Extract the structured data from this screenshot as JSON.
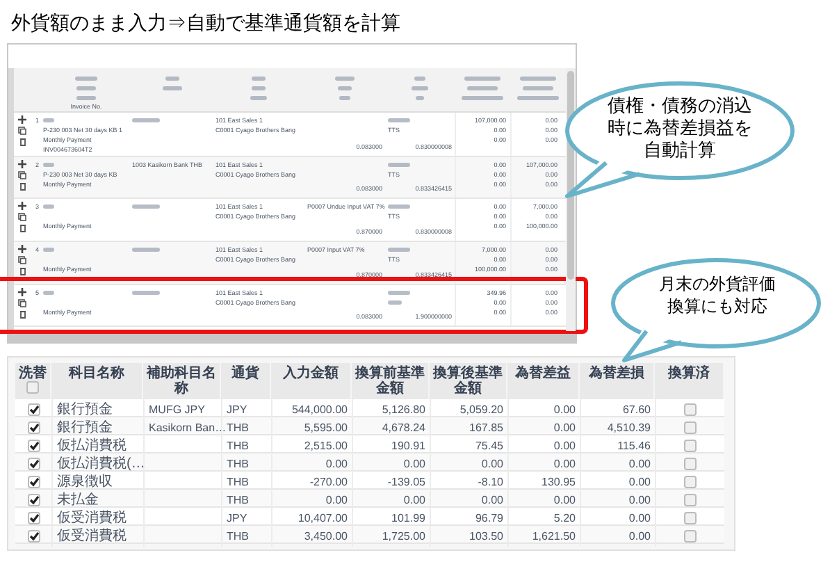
{
  "title": "外貨額のまま入力⇒自動で基準通貨額を計算",
  "journal": {
    "header_note": "Invoice No.",
    "rows": [
      {
        "number": "1",
        "payment": [
          "P-230 003 Net 30 days KB 1",
          "Monthly Payment",
          "INV004673604T2"
        ],
        "account": [],
        "department": [
          "101 East Sales 1",
          "C0001 Cyago Brothers Bang"
        ],
        "tax": [],
        "tax_rate": "0.083000",
        "rate_type": "TTS",
        "exchange_rate": "0.830000008",
        "debit": [
          "107,000.00",
          "0.00",
          "0.00"
        ],
        "credit": [
          "0.00",
          "0.00",
          "0.00"
        ],
        "highlighted": false
      },
      {
        "number": "2",
        "payment": [
          "P-230 003 Net 30 days KB",
          "Monthly Payment"
        ],
        "account": [
          "1003 Kasikorn Bank THB"
        ],
        "department": [
          "101 East Sales 1",
          "C0001 Cyago Brothers Bang"
        ],
        "tax": [],
        "tax_rate": "0.083000",
        "rate_type": "TTS",
        "exchange_rate": "0.833426415",
        "debit": [
          "0.00",
          "0.00",
          "0.00"
        ],
        "credit": [
          "107,000.00",
          "0.00",
          "0.00"
        ],
        "highlighted": false
      },
      {
        "number": "3",
        "payment": [
          "Monthly Payment"
        ],
        "account": [],
        "department": [
          "101 East Sales 1",
          "C0001 Cyago Brothers Bang"
        ],
        "tax": [
          "P0007 Undue Input VAT 7%"
        ],
        "tax_rate": "0.870000",
        "rate_type": "TTS",
        "exchange_rate": "0.830000008",
        "debit": [
          "0.00",
          "0.00",
          "0.00"
        ],
        "credit": [
          "7,000.00",
          "0.00",
          "100,000.00"
        ],
        "highlighted": false
      },
      {
        "number": "4",
        "payment": [
          "Monthly Payment"
        ],
        "account": [],
        "department": [
          "101 East Sales 1",
          "C0001 Cyago Brothers Bang"
        ],
        "tax": [
          "P0007 Input VAT 7%"
        ],
        "tax_rate": "0.870000",
        "rate_type": "TTS",
        "exchange_rate": "0.833426415",
        "debit": [
          "7,000.00",
          "0.00",
          "100,000.00"
        ],
        "credit": [
          "0.00",
          "0.00",
          "0.00"
        ],
        "highlighted": false
      },
      {
        "number": "5",
        "payment": [
          "Monthly Payment"
        ],
        "account": [],
        "department": [
          "101 East Sales 1",
          "C0001 Cyago Brothers Bang"
        ],
        "tax": [],
        "tax_rate": "0.083000",
        "rate_type": "",
        "exchange_rate": "1.900000000",
        "debit": [
          "349.96",
          "0.00",
          "0.00"
        ],
        "credit": [
          "0.00",
          "0.00",
          "0.00"
        ],
        "highlighted": true
      }
    ]
  },
  "callouts": [
    {
      "text": "債権・債務の消込時に為替差損益を自動計算"
    },
    {
      "text": "月末の外貨評価換算にも対応"
    }
  ],
  "reval_table": {
    "checkbox_column": "洗替",
    "columns": [
      "科目名称",
      "補助科目名称",
      "通貨",
      "入力金額",
      "換算前基準金額",
      "換算後基準金額",
      "為替差益",
      "為替差損"
    ],
    "status_column": "換算済",
    "select_all_checked": false,
    "rows": [
      {
        "reval": true,
        "cells": [
          "銀行預金",
          "MUFG JPY",
          "JPY",
          "544,000.00",
          "5,126.80",
          "5,059.20",
          "0.00",
          "67.60"
        ],
        "converted": false
      },
      {
        "reval": true,
        "cells": [
          "銀行預金",
          "Kasikorn Ban…",
          "THB",
          "5,595.00",
          "4,678.24",
          "167.85",
          "0.00",
          "4,510.39"
        ],
        "converted": false
      },
      {
        "reval": true,
        "cells": [
          "仮払消費税",
          "",
          "THB",
          "2,515.00",
          "190.91",
          "75.45",
          "0.00",
          "115.46"
        ],
        "converted": false
      },
      {
        "reval": true,
        "cells": [
          "仮払消費税(…",
          "",
          "THB",
          "0.00",
          "0.00",
          "0.00",
          "0.00",
          "0.00"
        ],
        "converted": false
      },
      {
        "reval": true,
        "cells": [
          "源泉徴収",
          "",
          "THB",
          "-270.00",
          "-139.05",
          "-8.10",
          "130.95",
          "0.00"
        ],
        "converted": false
      },
      {
        "reval": true,
        "cells": [
          "未払金",
          "",
          "THB",
          "0.00",
          "0.00",
          "0.00",
          "0.00",
          "0.00"
        ],
        "converted": false
      },
      {
        "reval": true,
        "cells": [
          "仮受消費税",
          "",
          "JPY",
          "10,407.00",
          "101.99",
          "96.79",
          "5.20",
          "0.00"
        ],
        "converted": false
      },
      {
        "reval": true,
        "cells": [
          "仮受消費税",
          "",
          "THB",
          "3,450.00",
          "1,725.00",
          "103.50",
          "1,621.50",
          "0.00"
        ],
        "converted": false
      }
    ]
  }
}
